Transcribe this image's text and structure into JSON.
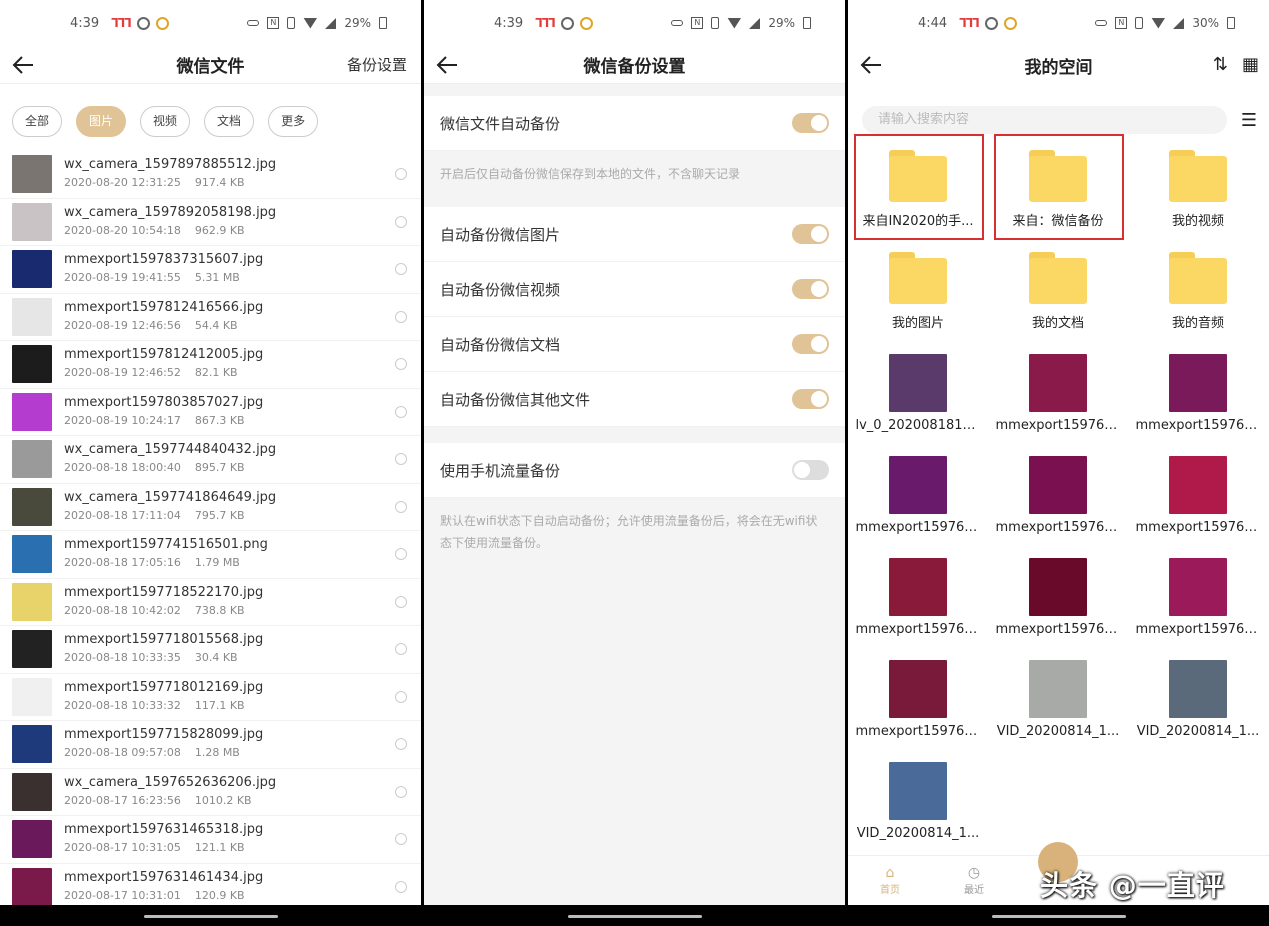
{
  "panel1": {
    "status": {
      "time": "4:39",
      "battery": "29%"
    },
    "title": "微信文件",
    "right_action": "备份设置",
    "chips": [
      {
        "label": "全部",
        "active": false
      },
      {
        "label": "图片",
        "active": true
      },
      {
        "label": "视频",
        "active": false
      },
      {
        "label": "文档",
        "active": false
      },
      {
        "label": "更多",
        "active": false
      }
    ],
    "files": [
      {
        "name": "wx_camera_1597897885512.jpg",
        "date": "2020-08-20 12:31:25",
        "size": "917.4 KB",
        "color": "#7a7570"
      },
      {
        "name": "wx_camera_1597892058198.jpg",
        "date": "2020-08-20 10:54:18",
        "size": "962.9 KB",
        "color": "#c9c3c6"
      },
      {
        "name": "mmexport1597837315607.jpg",
        "date": "2020-08-19 19:41:55",
        "size": "5.31 MB",
        "color": "#1a2a6e"
      },
      {
        "name": "mmexport1597812416566.jpg",
        "date": "2020-08-19 12:46:56",
        "size": "54.4 KB",
        "color": "#e6e6e6"
      },
      {
        "name": "mmexport1597812412005.jpg",
        "date": "2020-08-19 12:46:52",
        "size": "82.1 KB",
        "color": "#1c1c1c"
      },
      {
        "name": "mmexport1597803857027.jpg",
        "date": "2020-08-19 10:24:17",
        "size": "867.3 KB",
        "color": "#b43ccf"
      },
      {
        "name": "wx_camera_1597744840432.jpg",
        "date": "2020-08-18 18:00:40",
        "size": "895.7 KB",
        "color": "#9a9a9a"
      },
      {
        "name": "wx_camera_1597741864649.jpg",
        "date": "2020-08-18 17:11:04",
        "size": "795.7 KB",
        "color": "#4a4a3c"
      },
      {
        "name": "mmexport1597741516501.png",
        "date": "2020-08-18 17:05:16",
        "size": "1.79 MB",
        "color": "#2a6fb0"
      },
      {
        "name": "mmexport1597718522170.jpg",
        "date": "2020-08-18 10:42:02",
        "size": "738.8 KB",
        "color": "#e8d36a"
      },
      {
        "name": "mmexport1597718015568.jpg",
        "date": "2020-08-18 10:33:35",
        "size": "30.4 KB",
        "color": "#222222"
      },
      {
        "name": "mmexport1597718012169.jpg",
        "date": "2020-08-18 10:33:32",
        "size": "117.1 KB",
        "color": "#f0f0f0"
      },
      {
        "name": "mmexport1597715828099.jpg",
        "date": "2020-08-18 09:57:08",
        "size": "1.28 MB",
        "color": "#1e3a7a"
      },
      {
        "name": "wx_camera_1597652636206.jpg",
        "date": "2020-08-17 16:23:56",
        "size": "1010.2 KB",
        "color": "#3a3030"
      },
      {
        "name": "mmexport1597631465318.jpg",
        "date": "2020-08-17 10:31:05",
        "size": "121.1 KB",
        "color": "#6a1a5a"
      },
      {
        "name": "mmexport1597631461434.jpg",
        "date": "2020-08-17 10:31:01",
        "size": "120.9 KB",
        "color": "#7a1a4a"
      }
    ]
  },
  "panel2": {
    "status": {
      "time": "4:39",
      "battery": "29%"
    },
    "title": "微信备份设置",
    "auto_backup": {
      "label": "微信文件自动备份",
      "on": true
    },
    "auto_note": "开启后仅自动备份微信保存到本地的文件，不含聊天记录",
    "options": [
      {
        "label": "自动备份微信图片",
        "on": true
      },
      {
        "label": "自动备份微信视频",
        "on": true
      },
      {
        "label": "自动备份微信文档",
        "on": true
      },
      {
        "label": "自动备份微信其他文件",
        "on": true
      }
    ],
    "mobile_data": {
      "label": "使用手机流量备份",
      "on": false
    },
    "mobile_note": "默认在wifi状态下自动启动备份；允许使用流量备份后，将会在无wifi状态下使用流量备份。"
  },
  "panel3": {
    "status": {
      "time": "4:44",
      "battery": "30%"
    },
    "title": "我的空间",
    "search_placeholder": "请输入搜索内容",
    "items": [
      {
        "label": "来自IN2020的手...",
        "kind": "folder",
        "highlight": true
      },
      {
        "label": "来自：微信备份",
        "kind": "folder",
        "highlight": true
      },
      {
        "label": "我的视频",
        "kind": "folder"
      },
      {
        "label": "我的图片",
        "kind": "folder"
      },
      {
        "label": "我的文档",
        "kind": "folder"
      },
      {
        "label": "我的音频",
        "kind": "folder"
      },
      {
        "label": "lv_0_2020081811...",
        "kind": "image",
        "color": "#5a3a6a"
      },
      {
        "label": "mmexport159763...",
        "kind": "image",
        "color": "#8a1a4a"
      },
      {
        "label": "mmexport159763...",
        "kind": "image",
        "color": "#7a1a5a"
      },
      {
        "label": "mmexport159763...",
        "kind": "image",
        "color": "#6a1a6a"
      },
      {
        "label": "mmexport159763...",
        "kind": "image",
        "color": "#7a1050"
      },
      {
        "label": "mmexport159763...",
        "kind": "image",
        "color": "#b01a4a"
      },
      {
        "label": "mmexport159763...",
        "kind": "image",
        "color": "#8a1a3a"
      },
      {
        "label": "mmexport159763...",
        "kind": "image",
        "color": "#6a0a2a"
      },
      {
        "label": "mmexport159763...",
        "kind": "image",
        "color": "#9a1a5a"
      },
      {
        "label": "mmexport159763...",
        "kind": "image",
        "color": "#7a1a3a"
      },
      {
        "label": "VID_20200814_1...",
        "kind": "image",
        "color": "#a8aaa8"
      },
      {
        "label": "VID_20200814_1...",
        "kind": "image",
        "color": "#5a6a7a"
      },
      {
        "label": "VID_20200814_1...",
        "kind": "image",
        "color": "#4a6a9a"
      }
    ],
    "bottom_nav": [
      {
        "label": "首页",
        "active": true
      },
      {
        "label": "最近",
        "active": false
      }
    ]
  },
  "watermark": "头条 @一直评"
}
